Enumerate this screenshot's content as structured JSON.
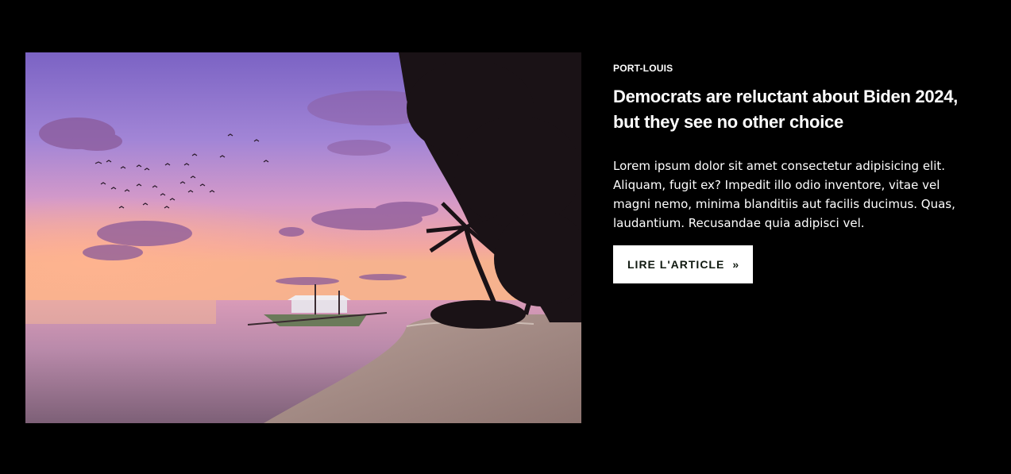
{
  "article": {
    "location": "PORT-LOUIS",
    "headline": "Democrats are reluctant about Biden 2024, but they see no other choice",
    "excerpt": "Lorem ipsum dolor sit amet consectetur adipisicing elit. Aliquam, fugit ex? Impedit illo odio inventore, vitae vel magni nemo, minima blanditiis aut facilis ducimus. Quas, laudantium. Recusandae quia adipisci vel.",
    "cta_label": "LIRE L'ARTICLE",
    "cta_icon": "double-chevron-right-icon"
  },
  "colors": {
    "page_background": "#000000",
    "text": "#ffffff",
    "button_background": "#ffffff",
    "button_text": "#111a11"
  },
  "image": {
    "subject": "sunset-beach-with-boat-and-palm-trees"
  }
}
